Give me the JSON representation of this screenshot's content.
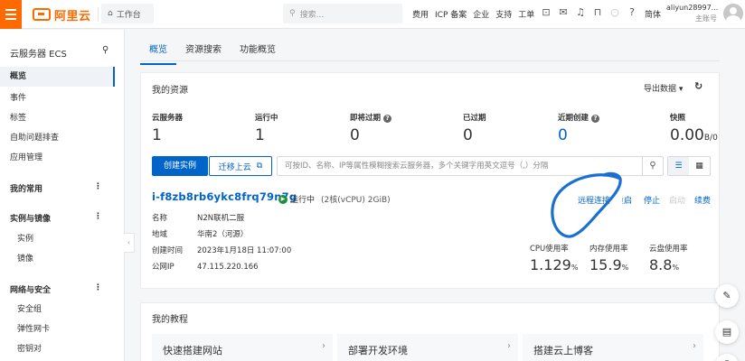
{
  "topbar": {
    "logo_text": "阿里云",
    "workbench_label": "工作台",
    "search_placeholder": "搜索...",
    "links": [
      "费用",
      "ICP 备案",
      "企业",
      "支持",
      "工单"
    ],
    "lang": "简体",
    "user_name": "aliyun28997...",
    "user_role": "主账号"
  },
  "sidebar": {
    "title": "云服务器 ECS",
    "items": [
      "概览",
      "事件",
      "标签",
      "自助问题排查",
      "应用管理"
    ],
    "groups": [
      "我的常用",
      "实例与镜像",
      "网络与安全"
    ],
    "instance_subitems": [
      "实例",
      "镜像"
    ],
    "network_subitems": [
      "安全组",
      "弹性网卡",
      "密钥对"
    ]
  },
  "tabs": [
    "概览",
    "资源搜索",
    "功能概览"
  ],
  "resources": {
    "title": "我的资源",
    "export_label": "导出数据",
    "stats": [
      {
        "label": "云服务器",
        "value": "1"
      },
      {
        "label": "运行中",
        "value": "1"
      },
      {
        "label": "即将过期",
        "value": "0"
      },
      {
        "label": "已过期",
        "value": "0"
      },
      {
        "label": "近期创建",
        "value": "0"
      },
      {
        "label": "快照",
        "value": "0.00",
        "unit": "B/0"
      }
    ],
    "create_button": "创建实例",
    "migrate_button": "迁移上云",
    "filter_placeholder": "可按ID、名称、IP等属性模糊搜索云服务器，多个关键字用英文逗号（,）分隔",
    "instance": {
      "id": "i-f8zb8rb6ykc8frq79n7g",
      "status": "运行中",
      "spec": "(2核(vCPU) 2GiB)",
      "fields": [
        {
          "key": "名称",
          "value": "N2N联机二服"
        },
        {
          "key": "地域",
          "value": "华南2（河源）"
        },
        {
          "key": "创建时间",
          "value": "2023年1月18日 11:07:00"
        },
        {
          "key": "公网IP",
          "value": "47.115.220.166"
        }
      ],
      "actions": [
        "远程连接",
        "重启",
        "停止",
        "启动",
        "续费"
      ],
      "metrics": [
        {
          "label": "CPU使用率",
          "value": "1.129",
          "unit": "%"
        },
        {
          "label": "内存使用率",
          "value": "15.9",
          "unit": "%"
        },
        {
          "label": "云盘使用率",
          "value": "8.8",
          "unit": "%"
        }
      ]
    }
  },
  "tutorials": {
    "title": "我的教程",
    "items": [
      "快速搭建网站",
      "部署开发环境",
      "搭建云上博客"
    ]
  },
  "colors": {
    "brand": "#ff6a00",
    "primary": "#0064c8",
    "running": "#1e8e3e"
  }
}
